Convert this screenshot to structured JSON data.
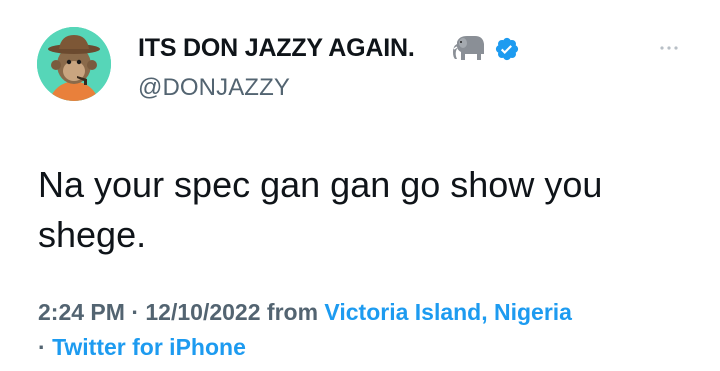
{
  "tweet": {
    "author": {
      "display_name": "ITS DON JAZZY AGAIN.",
      "handle": "@DONJAZZY",
      "badges": [
        "elephant-icon",
        "verified-icon"
      ],
      "verified_color": "#1d9bf0"
    },
    "text_line1": "Na your spec gan gan go show you",
    "text_line2": "shege.",
    "time": "2:24 PM",
    "separator": "·",
    "date": "12/10/2022",
    "from_word": "from",
    "location": "Victoria Island, Nigeria",
    "source": "Twitter for iPhone",
    "more_icon": "more-horizontal-icon"
  },
  "colors": {
    "text": "#0f1419",
    "secondary": "#536471",
    "link": "#1d9bf0",
    "avatar_bg": "#56d6b8"
  }
}
